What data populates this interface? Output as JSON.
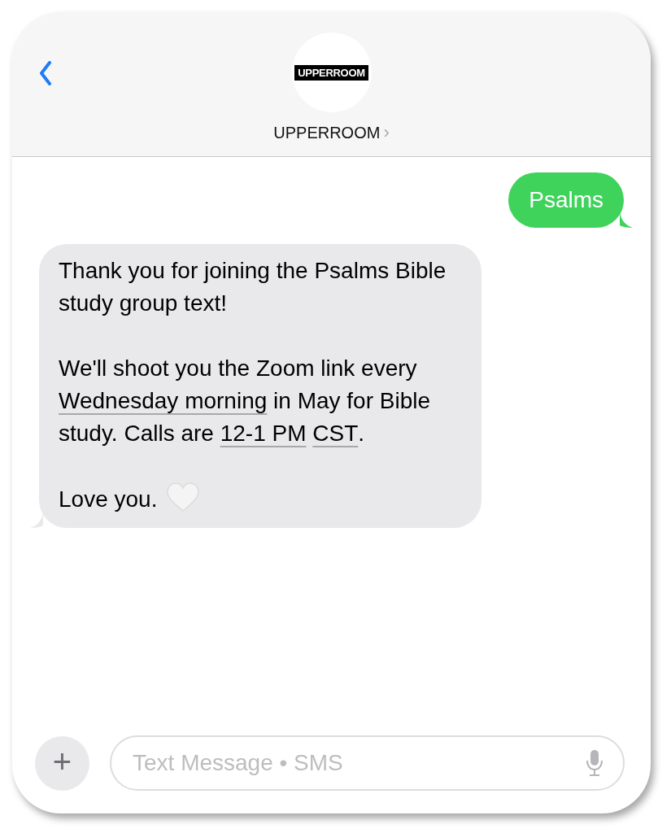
{
  "header": {
    "logo_text": "UPPERROOM",
    "contact_name": "UPPERROOM",
    "chevron": "›"
  },
  "messages": [
    {
      "kind": "sent",
      "paragraphs": [
        [
          {
            "kind": "text",
            "text": "Psalms"
          }
        ]
      ]
    },
    {
      "kind": "received",
      "paragraphs": [
        [
          {
            "kind": "text",
            "text": "Thank you for joining the Psalms Bible study group text!"
          }
        ],
        [
          {
            "kind": "text",
            "text": "We'll shoot you the Zoom link every "
          },
          {
            "kind": "link",
            "text": "Wednesday morning"
          },
          {
            "kind": "text",
            "text": " in May for Bible study. Calls are "
          },
          {
            "kind": "link",
            "text": "12-1 PM"
          },
          {
            "kind": "link",
            "text": "CST"
          },
          {
            "kind": "text",
            "text": "."
          }
        ],
        [
          {
            "kind": "text",
            "text": "Love you."
          },
          {
            "kind": "heart"
          }
        ]
      ]
    }
  ],
  "composer": {
    "plus": "+",
    "placeholder": "Text Message • SMS"
  }
}
